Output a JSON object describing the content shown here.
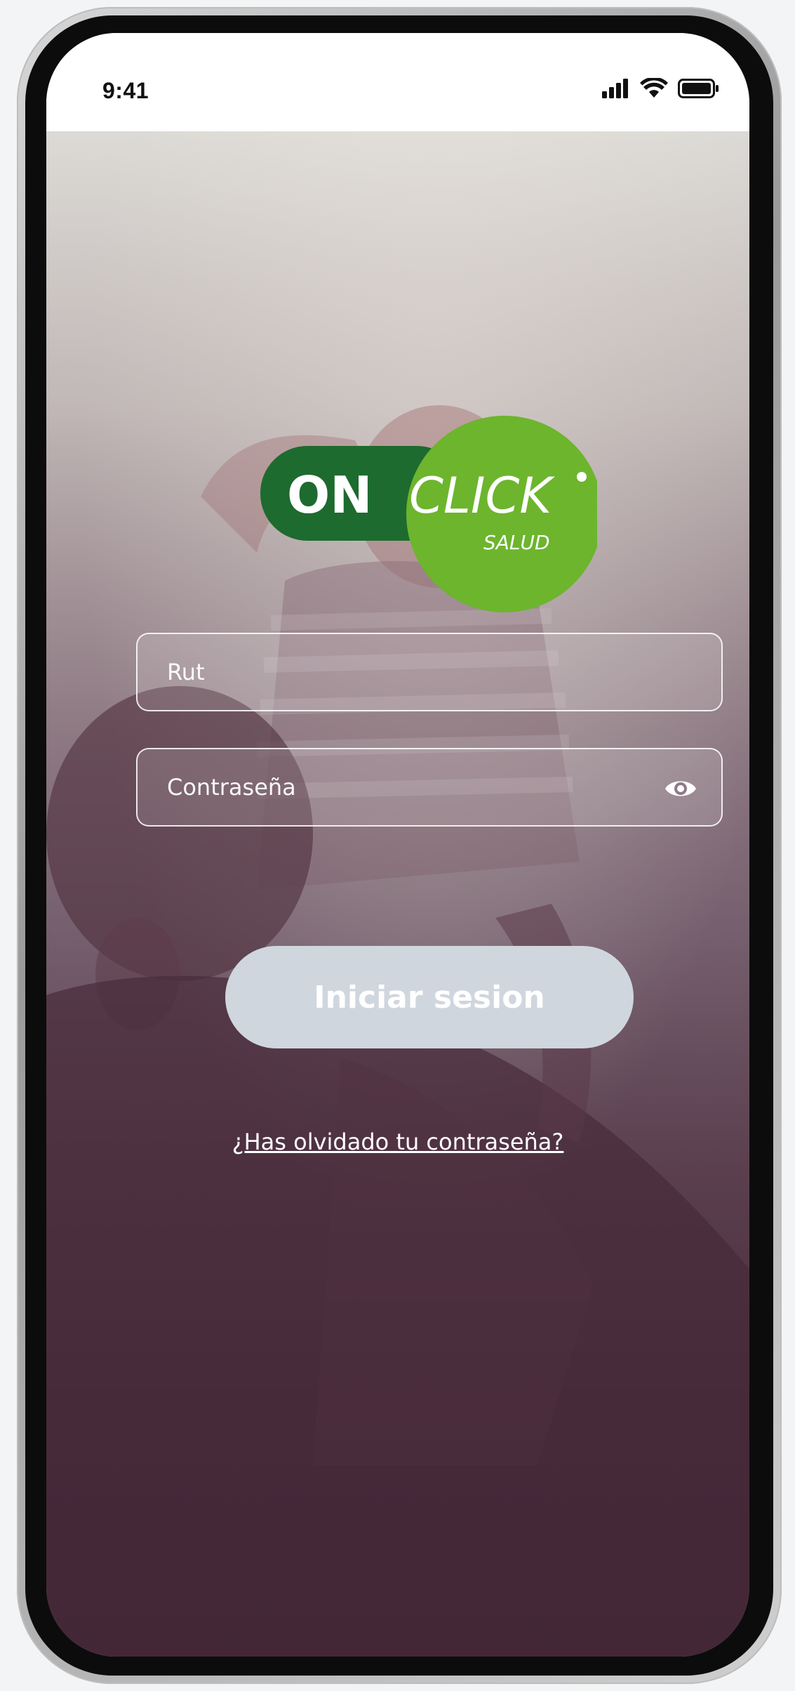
{
  "status_bar": {
    "time": "9:41",
    "icons": [
      "cellular-signal-icon",
      "wifi-icon",
      "battery-icon"
    ]
  },
  "logo": {
    "on": "ON",
    "click": "CLICK",
    "salud": "SALUD",
    "colors": {
      "dark_green": "#1d6b2e",
      "light_green": "#6cb52d",
      "text": "#ffffff"
    }
  },
  "form": {
    "rut_placeholder": "Rut",
    "password_placeholder": "Contraseña",
    "password_toggle_icon": "eye-icon",
    "submit_label": "Iniciar sesion",
    "forgot_password": "¿Has olvidado tu contraseña?"
  },
  "colors": {
    "button_bg": "#d0d6de",
    "field_border": "#ffffff"
  }
}
